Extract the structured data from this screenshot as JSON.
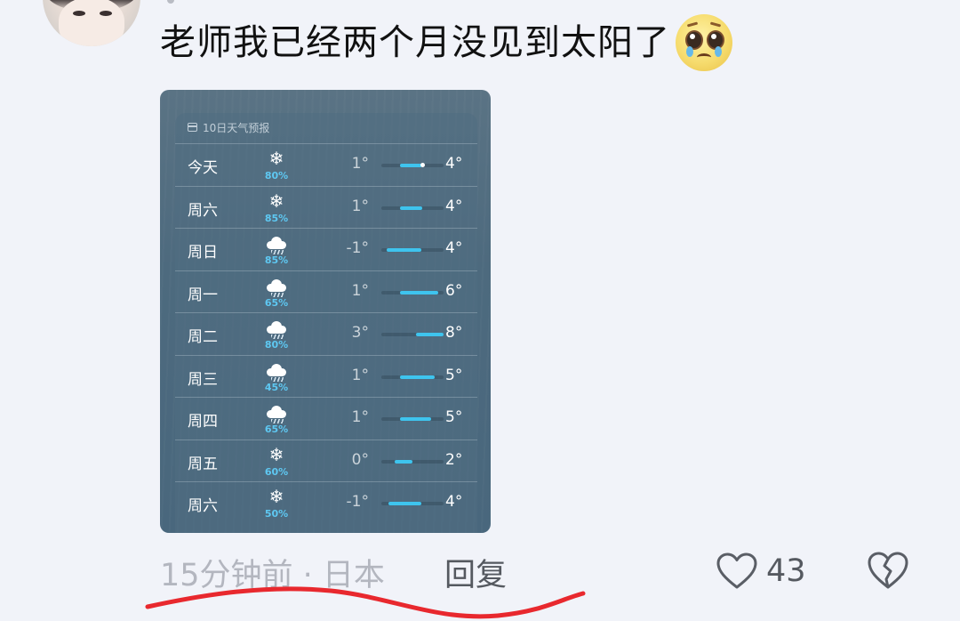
{
  "comment": {
    "text": "老师我已经两个月没见到太阳了",
    "emoji_icon": "pleading-face-emoji"
  },
  "weather_card": {
    "header": "10日天气预报",
    "header_icon": "calendar-icon",
    "rows": [
      {
        "day": "今天",
        "icon": "snow-icon",
        "precip": "80%",
        "low": "1°",
        "high": "4°",
        "range_start": 0.3,
        "range_end": 0.65,
        "current": 0.65
      },
      {
        "day": "周六",
        "icon": "snow-icon",
        "precip": "85%",
        "low": "1°",
        "high": "4°",
        "range_start": 0.3,
        "range_end": 0.65
      },
      {
        "day": "周日",
        "icon": "snow-cloud-icon",
        "precip": "85%",
        "low": "-1°",
        "high": "4°",
        "range_start": 0.08,
        "range_end": 0.65
      },
      {
        "day": "周一",
        "icon": "rain-cloud-icon",
        "precip": "65%",
        "low": "1°",
        "high": "6°",
        "range_start": 0.3,
        "range_end": 0.92
      },
      {
        "day": "周二",
        "icon": "rain-cloud-icon",
        "precip": "80%",
        "low": "3°",
        "high": "8°",
        "range_start": 0.55,
        "range_end": 1.12
      },
      {
        "day": "周三",
        "icon": "rain-cloud-icon",
        "precip": "45%",
        "low": "1°",
        "high": "5°",
        "range_start": 0.3,
        "range_end": 0.85
      },
      {
        "day": "周四",
        "icon": "rain-cloud-icon",
        "precip": "65%",
        "low": "1°",
        "high": "5°",
        "range_start": 0.3,
        "range_end": 0.8
      },
      {
        "day": "周五",
        "icon": "snow-icon",
        "precip": "60%",
        "low": "0°",
        "high": "2°",
        "range_start": 0.22,
        "range_end": 0.5
      },
      {
        "day": "周六",
        "icon": "snow-icon",
        "precip": "50%",
        "low": "-1°",
        "high": "4°",
        "range_start": 0.12,
        "range_end": 0.65
      }
    ]
  },
  "footer": {
    "meta": "15分钟前 · 日本",
    "reply_label": "回复",
    "like_count": "43",
    "like_icon": "heart-outline-icon",
    "dislike_icon": "broken-heart-icon"
  },
  "annotation_color": "#e8282e"
}
